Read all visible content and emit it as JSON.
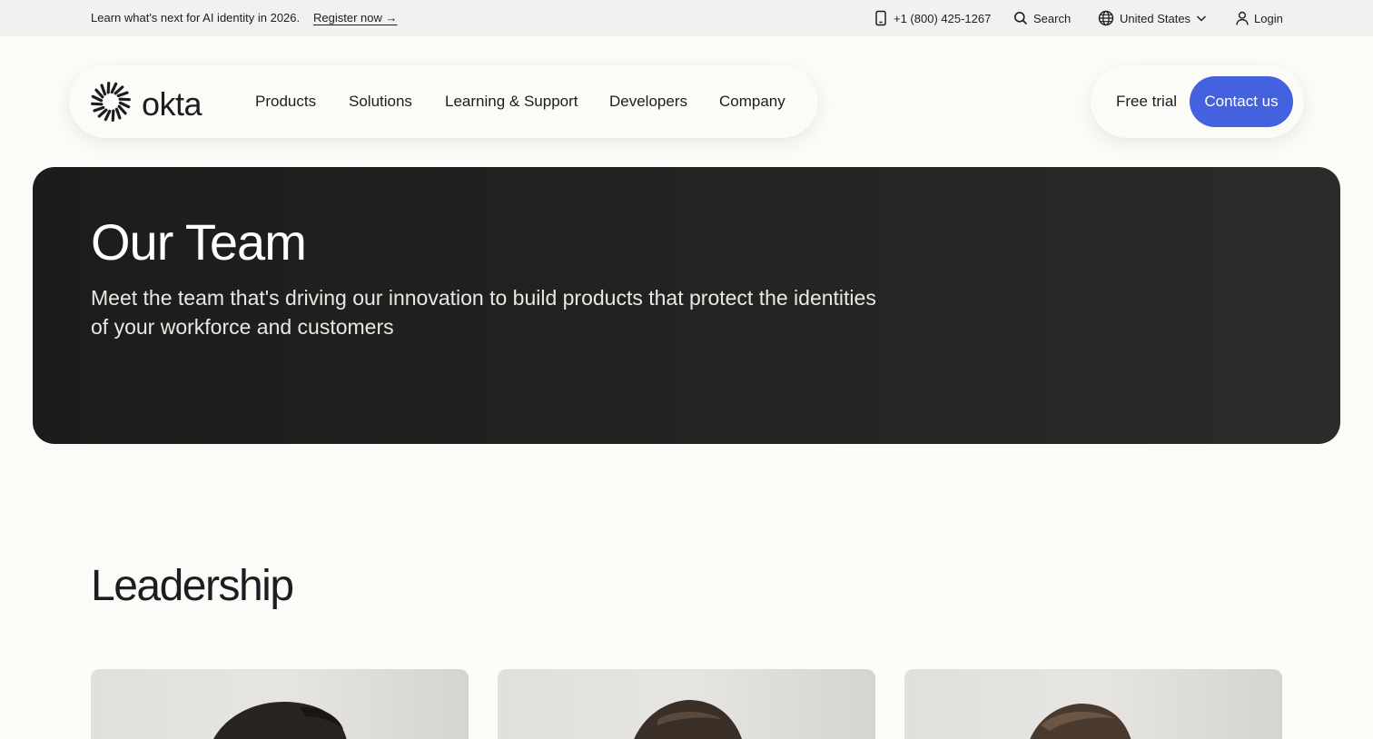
{
  "topbar": {
    "promo_text": "Learn what's next for AI identity in 2026.",
    "register_label": "Register now →",
    "phone": "+1 (800) 425-1267",
    "search_label": "Search",
    "region_label": "United States",
    "login_label": "Login"
  },
  "nav": {
    "logo_text": "okta",
    "items": [
      "Products",
      "Solutions",
      "Learning & Support",
      "Developers",
      "Company"
    ],
    "free_trial_label": "Free trial",
    "contact_label": "Contact us"
  },
  "hero": {
    "title": "Our Team",
    "subtitle": "Meet the team that's driving our innovation to build products that protect the identities of your workforce and customers"
  },
  "leadership": {
    "heading": "Leadership"
  },
  "colors": {
    "accent": "#4461e0",
    "hero_background": "#1c1c1c",
    "page_background": "#fcfbf8",
    "topbar_background": "#f1f1ef"
  },
  "icons": [
    "phone-icon",
    "search-icon",
    "globe-icon",
    "chevron-down-icon",
    "user-icon",
    "okta-logo-icon"
  ]
}
